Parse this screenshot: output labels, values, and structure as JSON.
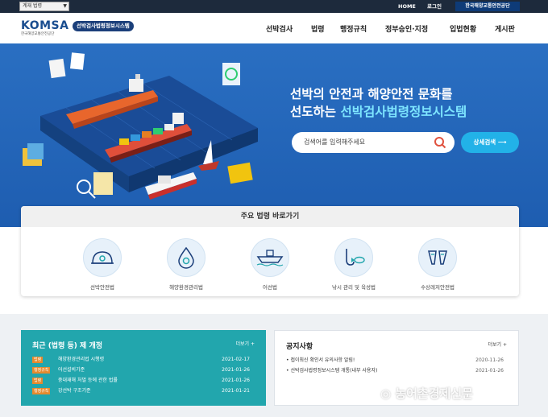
{
  "utility_bar": {
    "site_select": "계재 법령",
    "links": [
      "HOME",
      "로그인"
    ],
    "agency_badge": "한국해양교통안전공단"
  },
  "header": {
    "logo_text": "KOMSA",
    "logo_subtext": "한국해양교통안전공단",
    "logo_pill": "선박검사법령정보시스템",
    "nav": [
      "선박검사",
      "법령",
      "행정규칙",
      "정부승인·지정",
      "입법현황",
      "게시판"
    ]
  },
  "hero": {
    "headline_line1": "선박의 안전과 해양안전 문화를",
    "headline_line2_prefix": "선도하는 ",
    "headline_line2_highlight": "선박검사법령정보시스템",
    "search_placeholder": "검색어를 입력해주세요",
    "detail_search_label": "상세검색 ⟶"
  },
  "quick_links": {
    "title": "주요 법령 바로가기",
    "items": [
      {
        "label": "선박안전법",
        "icon": "helmet-icon"
      },
      {
        "label": "해양환경관리법",
        "icon": "water-drop-icon"
      },
      {
        "label": "어선법",
        "icon": "fishing-boat-icon"
      },
      {
        "label": "낚시 관리 및 육성법",
        "icon": "fishing-hook-icon"
      },
      {
        "label": "수상레저안전법",
        "icon": "flippers-icon"
      }
    ]
  },
  "recent_laws": {
    "title": "최근 (법령 등) 제 개정",
    "more": "더보기 +",
    "rows": [
      {
        "badge": "법령",
        "text": "해양환경관리법 시행령",
        "date": "2021-02-17"
      },
      {
        "badge": "행정규칙",
        "text": "어선설비기준",
        "date": "2021-01-26"
      },
      {
        "badge": "법령",
        "text": "중대재해 처벌 등에 관한 법률",
        "date": "2021-01-26"
      },
      {
        "badge": "행정규칙",
        "text": "강선박 구조기준",
        "date": "2021-01-21"
      }
    ]
  },
  "notices": {
    "title": "공지사항",
    "more": "더보기 +",
    "rows": [
      {
        "text": "접이최신 확인서 유의사항 알림!",
        "date": "2020-11-26"
      },
      {
        "text": "선박검사법령정보시스템 개통(내부 사용자)",
        "date": "2021-01-26"
      }
    ]
  },
  "watermark": "농어촌경제신문",
  "colors": {
    "hero_bg": "#2466b8",
    "accent_cyan": "#22b2e8",
    "recent_panel": "#22a6ad",
    "brand_navy": "#1b3f7a"
  }
}
